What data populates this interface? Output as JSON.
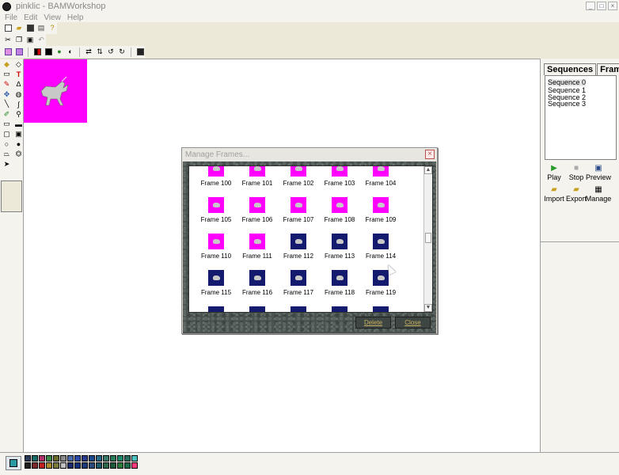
{
  "window": {
    "title": "pinklic - BAMWorkshop"
  },
  "menu": [
    "File",
    "Edit",
    "View",
    "Help"
  ],
  "right_panel": {
    "tabs": [
      "Sequences",
      "Frames"
    ],
    "sequences": [
      "Sequence 0",
      "Sequence 1",
      "Sequence 2",
      "Sequence 3"
    ],
    "play_labels": [
      "Play",
      "Stop",
      "Preview"
    ],
    "io_labels": [
      "Import",
      "Export",
      "Manage"
    ]
  },
  "dialog": {
    "title": "Manage Frames...",
    "delete_label": "Delete",
    "close_label": "Close",
    "frames": [
      {
        "label": "Frame 100",
        "color": "pink"
      },
      {
        "label": "Frame 101",
        "color": "pink"
      },
      {
        "label": "Frame 102",
        "color": "pink"
      },
      {
        "label": "Frame 103",
        "color": "pink"
      },
      {
        "label": "Frame 104",
        "color": "pink"
      },
      {
        "label": "Frame 105",
        "color": "pink"
      },
      {
        "label": "Frame 106",
        "color": "pink"
      },
      {
        "label": "Frame 107",
        "color": "pink"
      },
      {
        "label": "Frame 108",
        "color": "pink"
      },
      {
        "label": "Frame 109",
        "color": "pink"
      },
      {
        "label": "Frame 110",
        "color": "pink"
      },
      {
        "label": "Frame 111",
        "color": "pink"
      },
      {
        "label": "Frame 112",
        "color": "navy"
      },
      {
        "label": "Frame 113",
        "color": "navy"
      },
      {
        "label": "Frame 114",
        "color": "navy"
      },
      {
        "label": "Frame 115",
        "color": "navy"
      },
      {
        "label": "Frame 116",
        "color": "navy"
      },
      {
        "label": "Frame 117",
        "color": "navy"
      },
      {
        "label": "Frame 118",
        "color": "navy"
      },
      {
        "label": "Frame 119",
        "color": "navy"
      },
      {
        "label": "",
        "color": "navy"
      },
      {
        "label": "",
        "color": "navy"
      },
      {
        "label": "",
        "color": "navy"
      },
      {
        "label": "",
        "color": "navy"
      },
      {
        "label": "",
        "color": "navy"
      }
    ]
  },
  "colors": {
    "sprite_bg": "#ff00ff",
    "frame_navy": "#141a6e",
    "palette": [
      "#2a3a5a",
      "#1a6a6a",
      "#b0306a",
      "#3a8a4a",
      "#6a6a2a",
      "#8a8a8a",
      "#4a6aaa",
      "#2a4aaa",
      "#2a3a8a",
      "#1a4a8a",
      "#2a6a8a",
      "#3a7a6a",
      "#2a7a5a",
      "#1a8a6a",
      "#2a6a5a",
      "#202020",
      "#7a2a2a",
      "#c02020",
      "#aa8a2a",
      "#7a7a3a",
      "#c0c0c0",
      "#1a2a6a",
      "#10307a",
      "#1a3a7a",
      "#2a4a7a",
      "#1a5a6a",
      "#2a6a4a",
      "#1a5a3a",
      "#2a7a3a",
      "#1a6a4a"
    ],
    "palette_extra": [
      "#4ac0c0",
      "#ff3a7a"
    ]
  }
}
